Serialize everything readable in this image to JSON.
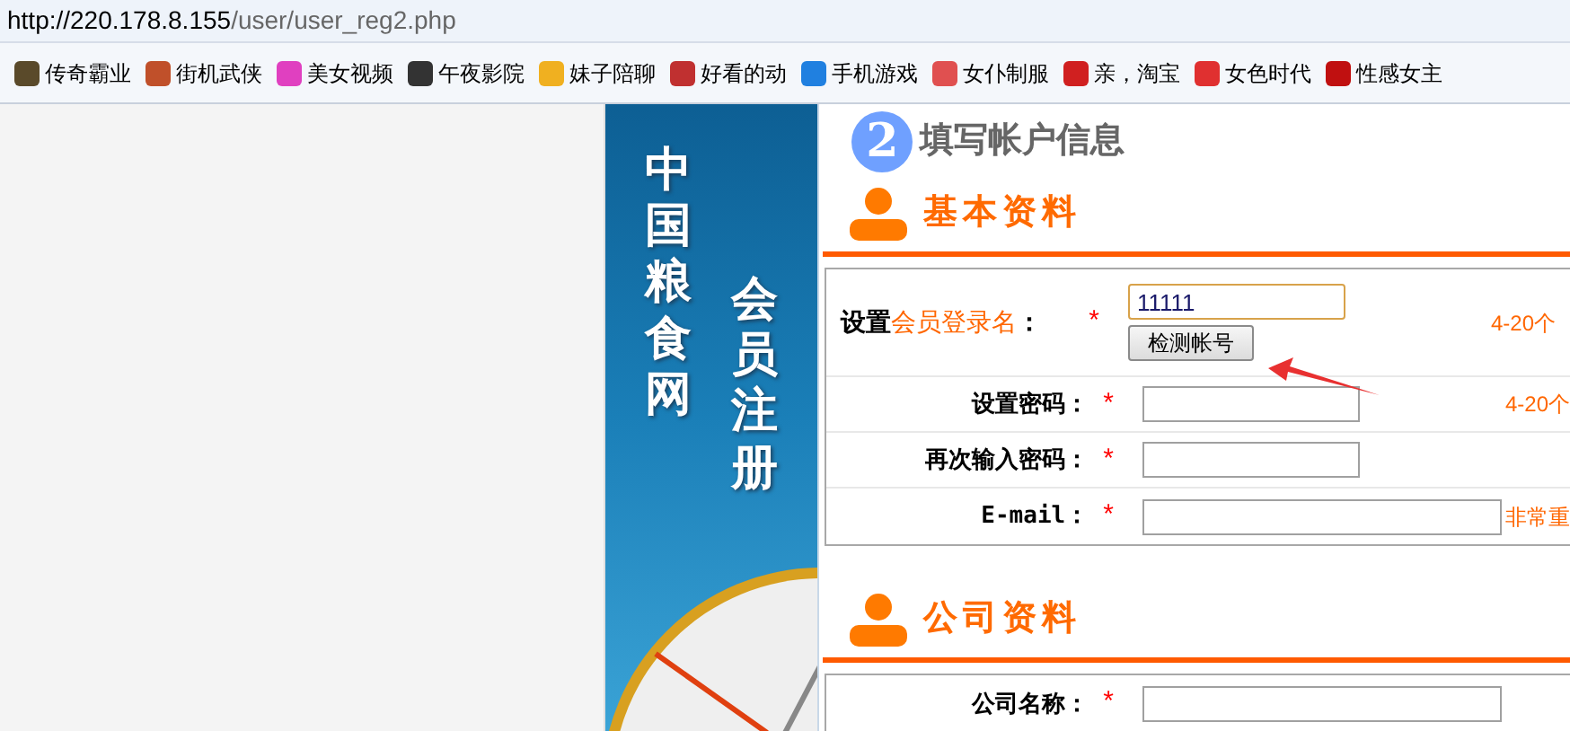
{
  "address_bar": {
    "host": "http://220.178.8.155",
    "path": "/user/user_reg2.php"
  },
  "bookmarks": [
    {
      "label": "传奇霸业",
      "color": "#5a4a2a"
    },
    {
      "label": "街机武侠",
      "color": "#c0502a"
    },
    {
      "label": "美女视频",
      "color": "#e040c0"
    },
    {
      "label": "午夜影院",
      "color": "#333333"
    },
    {
      "label": "妹子陪聊",
      "color": "#f0b020"
    },
    {
      "label": "好看的动",
      "color": "#c03030"
    },
    {
      "label": "手机游戏",
      "color": "#2080e0"
    },
    {
      "label": "女仆制服",
      "color": "#e05050"
    },
    {
      "label": "亲，淘宝",
      "color": "#d02020"
    },
    {
      "label": "女色时代",
      "color": "#e03030"
    },
    {
      "label": "性感女主",
      "color": "#c01010"
    }
  ],
  "banner": {
    "site_name": "中国粮食网",
    "subtitle": "会员注册"
  },
  "step": {
    "number": "2",
    "title": "填写帐户信息"
  },
  "sections": [
    {
      "title": "基本资料",
      "rows": [
        {
          "kind": "username",
          "label_prefix": "设置",
          "label_highlight": "会员登录名",
          "label_suffix": "：",
          "required": "*",
          "value": "11111",
          "focused": true,
          "button": "检测帐号",
          "hint": "4-20个"
        },
        {
          "kind": "password",
          "label": "设置密码：",
          "required": "*",
          "value": "",
          "focused": false,
          "hint": "4-20个"
        },
        {
          "kind": "password",
          "label": "再次输入密码：",
          "required": "*",
          "value": "",
          "focused": false
        },
        {
          "kind": "email",
          "label": "E-mail：",
          "required": "*",
          "value": "",
          "focused": false,
          "hint": "非常重"
        }
      ]
    },
    {
      "title": "公司资料",
      "rows": [
        {
          "kind": "text",
          "label": "公司名称：",
          "required": "*",
          "value": "",
          "focused": false
        }
      ]
    }
  ]
}
